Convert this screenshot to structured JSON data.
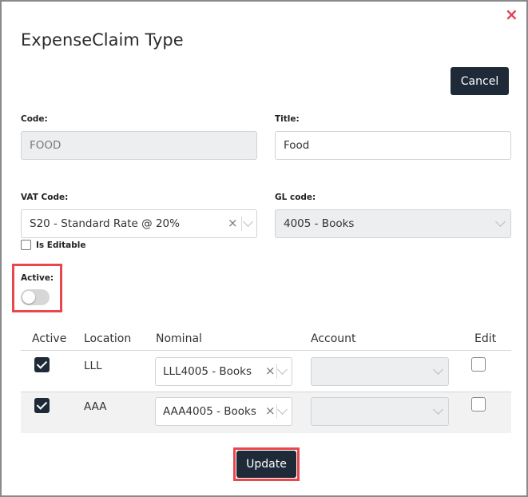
{
  "dialog": {
    "title": "ExpenseClaim Type",
    "close_icon": "×",
    "cancel_label": "Cancel",
    "update_label": "Update"
  },
  "form": {
    "code_label": "Code:",
    "code_value": "FOOD",
    "title_label": "Title:",
    "title_value": "Food",
    "vat_label": "VAT Code:",
    "vat_value": "S20 - Standard Rate @ 20%",
    "gl_label": "GL code:",
    "gl_value": "4005 - Books",
    "is_editable_label": "Is Editable",
    "is_editable_checked": false,
    "active_label": "Active:",
    "active_on": false
  },
  "table": {
    "headers": [
      "Active",
      "Location",
      "Nominal",
      "Account",
      "Edit"
    ],
    "rows": [
      {
        "active": true,
        "location": "LLL",
        "nominal": "LLL4005 - Books",
        "account": "",
        "edit": false
      },
      {
        "active": true,
        "location": "AAA",
        "nominal": "AAA4005 - Books",
        "account": "",
        "edit": false
      }
    ]
  },
  "icons": {
    "clear": "×"
  },
  "colors": {
    "dark_button": "#1f2a38",
    "highlight_border": "#e8484d",
    "close_icon": "#e0405a"
  }
}
